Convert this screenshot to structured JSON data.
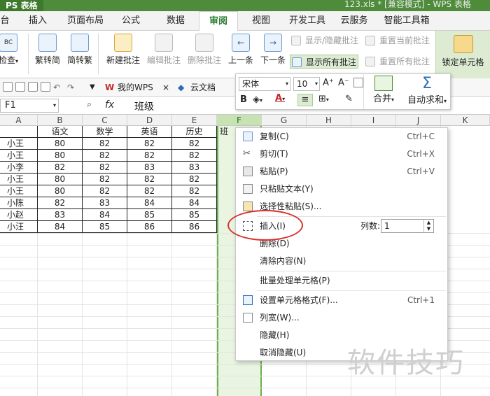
{
  "window": {
    "app_name": "PS 表格",
    "file_title": "123.xls * [兼容模式] - WPS 表格"
  },
  "tabs": [
    {
      "label": "台"
    },
    {
      "label": "插入"
    },
    {
      "label": "页面布局"
    },
    {
      "label": "公式"
    },
    {
      "label": "数据"
    },
    {
      "label": "审阅"
    },
    {
      "label": "视图"
    },
    {
      "label": "开发工具"
    },
    {
      "label": "云服务"
    },
    {
      "label": "智能工具箱"
    }
  ],
  "ribbon": {
    "check_label": "检查",
    "check_sub": "BC",
    "trad_to_simp": "繁转简",
    "simp_to_trad": "简转繁",
    "new_comment": "新建批注",
    "edit_comment": "编辑批注",
    "delete_comment": "删除批注",
    "prev": "上一条",
    "next": "下一条",
    "show_hide_comment": "显示/隐藏批注",
    "show_all_comments": "显示所有批注",
    "reset_current_comment": "重置当前批注",
    "reset_all_comments": "重置所有批注",
    "lock_cell": "锁定单元格"
  },
  "quickbar": {
    "my_wps": "我的WPS",
    "cloud_doc": "云文档",
    "close_x": "×"
  },
  "formula_bar": {
    "name_box": "F1",
    "fx": "fx",
    "content": "班级"
  },
  "columns": [
    "A",
    "B",
    "C",
    "D",
    "E",
    "F",
    "G",
    "H",
    "I",
    "J",
    "K"
  ],
  "table": {
    "headers": [
      "",
      "语文",
      "数学",
      "英语",
      "历史"
    ],
    "rows": [
      [
        "小王",
        "80",
        "82",
        "82",
        "82"
      ],
      [
        "小王",
        "80",
        "82",
        "82",
        "82"
      ],
      [
        "小李",
        "82",
        "82",
        "83",
        "83"
      ],
      [
        "小王",
        "80",
        "82",
        "82",
        "82"
      ],
      [
        "小王",
        "80",
        "82",
        "82",
        "82"
      ],
      [
        "小陈",
        "82",
        "83",
        "84",
        "84"
      ],
      [
        "小赵",
        "83",
        "84",
        "85",
        "85"
      ],
      [
        "小汪",
        "84",
        "85",
        "86",
        "86"
      ]
    ],
    "f1_partial": "班"
  },
  "mini_toolbar": {
    "font": "宋体",
    "size": "10",
    "grow": "A⁺",
    "shrink": "A⁻",
    "bold": "B",
    "merge": "合并",
    "autosum": "自动求和",
    "sum_symbol": "Σ"
  },
  "context_menu": {
    "copy": "复制(C)",
    "copy_key": "Ctrl+C",
    "cut": "剪切(T)",
    "cut_key": "Ctrl+X",
    "paste": "粘贴(P)",
    "paste_key": "Ctrl+V",
    "paste_text": "只粘贴文本(Y)",
    "paste_special": "选择性粘贴(S)...",
    "insert": "插入(I)",
    "columns_label": "列数:",
    "columns_value": "1",
    "delete": "删除(D)",
    "clear": "清除内容(N)",
    "batch": "批量处理单元格(P)",
    "format_cells": "设置单元格格式(F)...",
    "format_key": "Ctrl+1",
    "col_width": "列宽(W)...",
    "hide": "隐藏(H)",
    "unhide": "取消隐藏(U)"
  },
  "watermark": "软件技巧",
  "colors": {
    "accent_green": "#4e8b3a",
    "selection": "#6cb04a",
    "highlight": "#dcebd2",
    "annotation_red": "#d9322c"
  }
}
